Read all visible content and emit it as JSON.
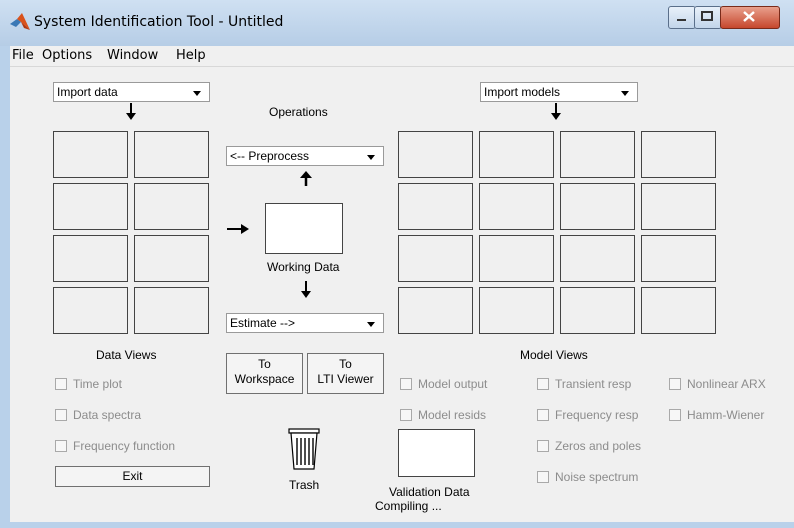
{
  "window": {
    "title": "System Identification Tool - Untitled"
  },
  "menu": [
    "File",
    "Options",
    "Window",
    "Help"
  ],
  "data_side": {
    "import_label": "Import data",
    "views_label": "Data Views",
    "checkboxes": [
      "Time plot",
      "Data spectra",
      "Frequency function"
    ],
    "exit_label": "Exit"
  },
  "operations": {
    "label": "Operations",
    "preprocess_label": "<-- Preprocess",
    "working_label": "Working Data",
    "estimate_label": "Estimate -->",
    "to_workspace_line1": "To",
    "to_workspace_line2": "Workspace",
    "to_lti_line1": "To",
    "to_lti_line2": "LTI Viewer",
    "trash_label": "Trash"
  },
  "model_side": {
    "import_label": "Import models",
    "views_label": "Model Views",
    "checkboxes_col1": [
      "Model output",
      "Model resids"
    ],
    "checkboxes_col2": [
      "Transient resp",
      "Frequency resp",
      "Zeros and poles",
      "Noise spectrum"
    ],
    "checkboxes_col3": [
      "Nonlinear ARX",
      "Hamm-Wiener"
    ],
    "validation_label": "Validation Data"
  },
  "status": "Compiling ..."
}
